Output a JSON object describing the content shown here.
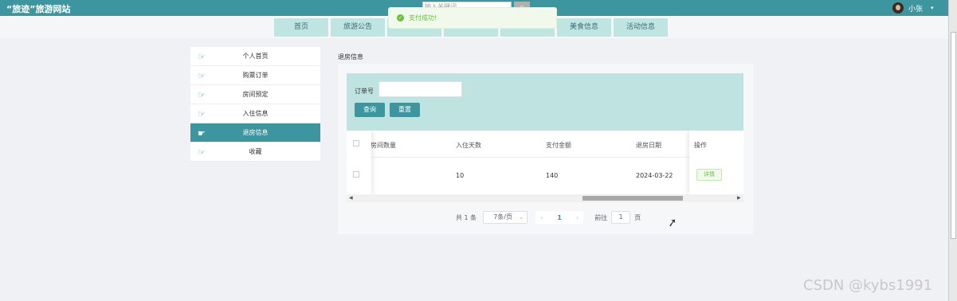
{
  "header": {
    "brand": "“旅迹”旅游网站",
    "search_placeholder": "输入关键词",
    "search_icon": "search-icon",
    "user_name": "小张",
    "user_caret": "▾"
  },
  "nav": {
    "tabs": [
      "首页",
      "旅游公告",
      "",
      "",
      "",
      "美食信息",
      "活动信息"
    ]
  },
  "toast": {
    "icon": "check-circle-icon",
    "message": "支付成功!"
  },
  "sidebar": {
    "items": [
      {
        "label": "个人首页",
        "icon": "hand-pointer-icon"
      },
      {
        "label": "购票订单",
        "icon": "hand-pointer-icon"
      },
      {
        "label": "房间预定",
        "icon": "hand-pointer-icon"
      },
      {
        "label": "入住信息",
        "icon": "hand-pointer-icon"
      },
      {
        "label": "退房信息",
        "icon": "hand-pointer-icon",
        "active": true
      },
      {
        "label": "收藏",
        "icon": "hand-pointer-icon"
      }
    ]
  },
  "main": {
    "section_title": "退房信息",
    "search": {
      "order_label": "订单号",
      "order_value": "",
      "query_button": "查询",
      "reset_button": "重置"
    },
    "table": {
      "columns": [
        "房间数量",
        "入住天数",
        "支付金额",
        "退房日期",
        "操作"
      ],
      "rows": [
        {
          "days": "10",
          "amount": "140",
          "date": "2024-03-22",
          "action": "详情"
        }
      ]
    },
    "pagination": {
      "total": "共 1 条",
      "page_size": "7条/页",
      "prev": "‹",
      "current": "1",
      "next": "›",
      "goto_label": "前往",
      "goto_value": "1",
      "page_suffix": "页"
    }
  },
  "watermark": "CSDN @kybs1991",
  "colors": {
    "primary": "#3d959f",
    "nav_tab": "#bfe4e2",
    "search_panel": "#bee3e1",
    "success": "#67c23a"
  }
}
